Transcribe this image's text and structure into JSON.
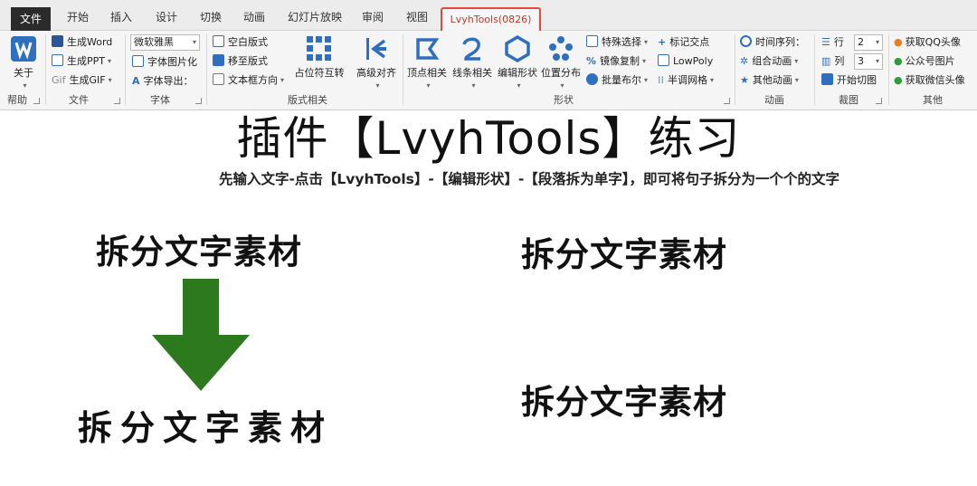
{
  "tabs": [
    {
      "label": "文件"
    },
    {
      "label": "开始"
    },
    {
      "label": "插入"
    },
    {
      "label": "设计"
    },
    {
      "label": "切换"
    },
    {
      "label": "动画"
    },
    {
      "label": "幻灯片放映"
    },
    {
      "label": "审阅"
    },
    {
      "label": "视图"
    },
    {
      "label": "LvyhTools(0826)"
    }
  ],
  "ribbon": {
    "help": {
      "button": "关于",
      "group": "帮助"
    },
    "file": {
      "items": [
        "生成Word",
        "生成PPT",
        "生成GIF"
      ],
      "gif_prefix": "Gif",
      "group": "文件"
    },
    "font": {
      "font_name": "微软雅黑",
      "items": [
        "字体图片化",
        "字体导出："
      ],
      "group": "字体"
    },
    "layout": {
      "items": [
        "空白版式",
        "移至版式",
        "文本框方向"
      ],
      "big_buttons": [
        "占位符互转",
        "高级对齐"
      ],
      "group": "版式相关"
    },
    "shape": {
      "big_buttons": [
        "顶点相关",
        "线条相关",
        "编辑形状",
        "位置分布"
      ],
      "items": [
        "特殊选择",
        "镜像复制",
        "批量布尔",
        "标记交点",
        "LowPoly",
        "半调网格"
      ],
      "group": "形状"
    },
    "animation": {
      "items": [
        "时间序列：",
        "组合动画",
        "其他动画"
      ],
      "group": "动画"
    },
    "crop": {
      "row_label": "行",
      "row_value": "2",
      "col_label": "列",
      "col_value": "3",
      "start": "开始切图",
      "group": "裁图"
    },
    "other": {
      "items": [
        "获取QQ头像",
        "公众号图片",
        "获取微信头像"
      ],
      "group": "其他"
    }
  },
  "slide": {
    "title": "插件【LvyhTools】练习",
    "subtitle": "先输入文字-点击【LvyhTools】-【编辑形状】-【段落拆为单字】，即可将句子拆分为一个个的文字",
    "words": [
      "拆分文字素材",
      "拆分文字素材",
      "拆分文字素材"
    ],
    "split_chars": [
      "拆",
      "分",
      "文",
      "字",
      "素",
      "材"
    ],
    "arrow_color": "#2d7a1e"
  },
  "colors": {
    "accent": "#2f6fbf",
    "highlight_border": "#e24a3b"
  }
}
